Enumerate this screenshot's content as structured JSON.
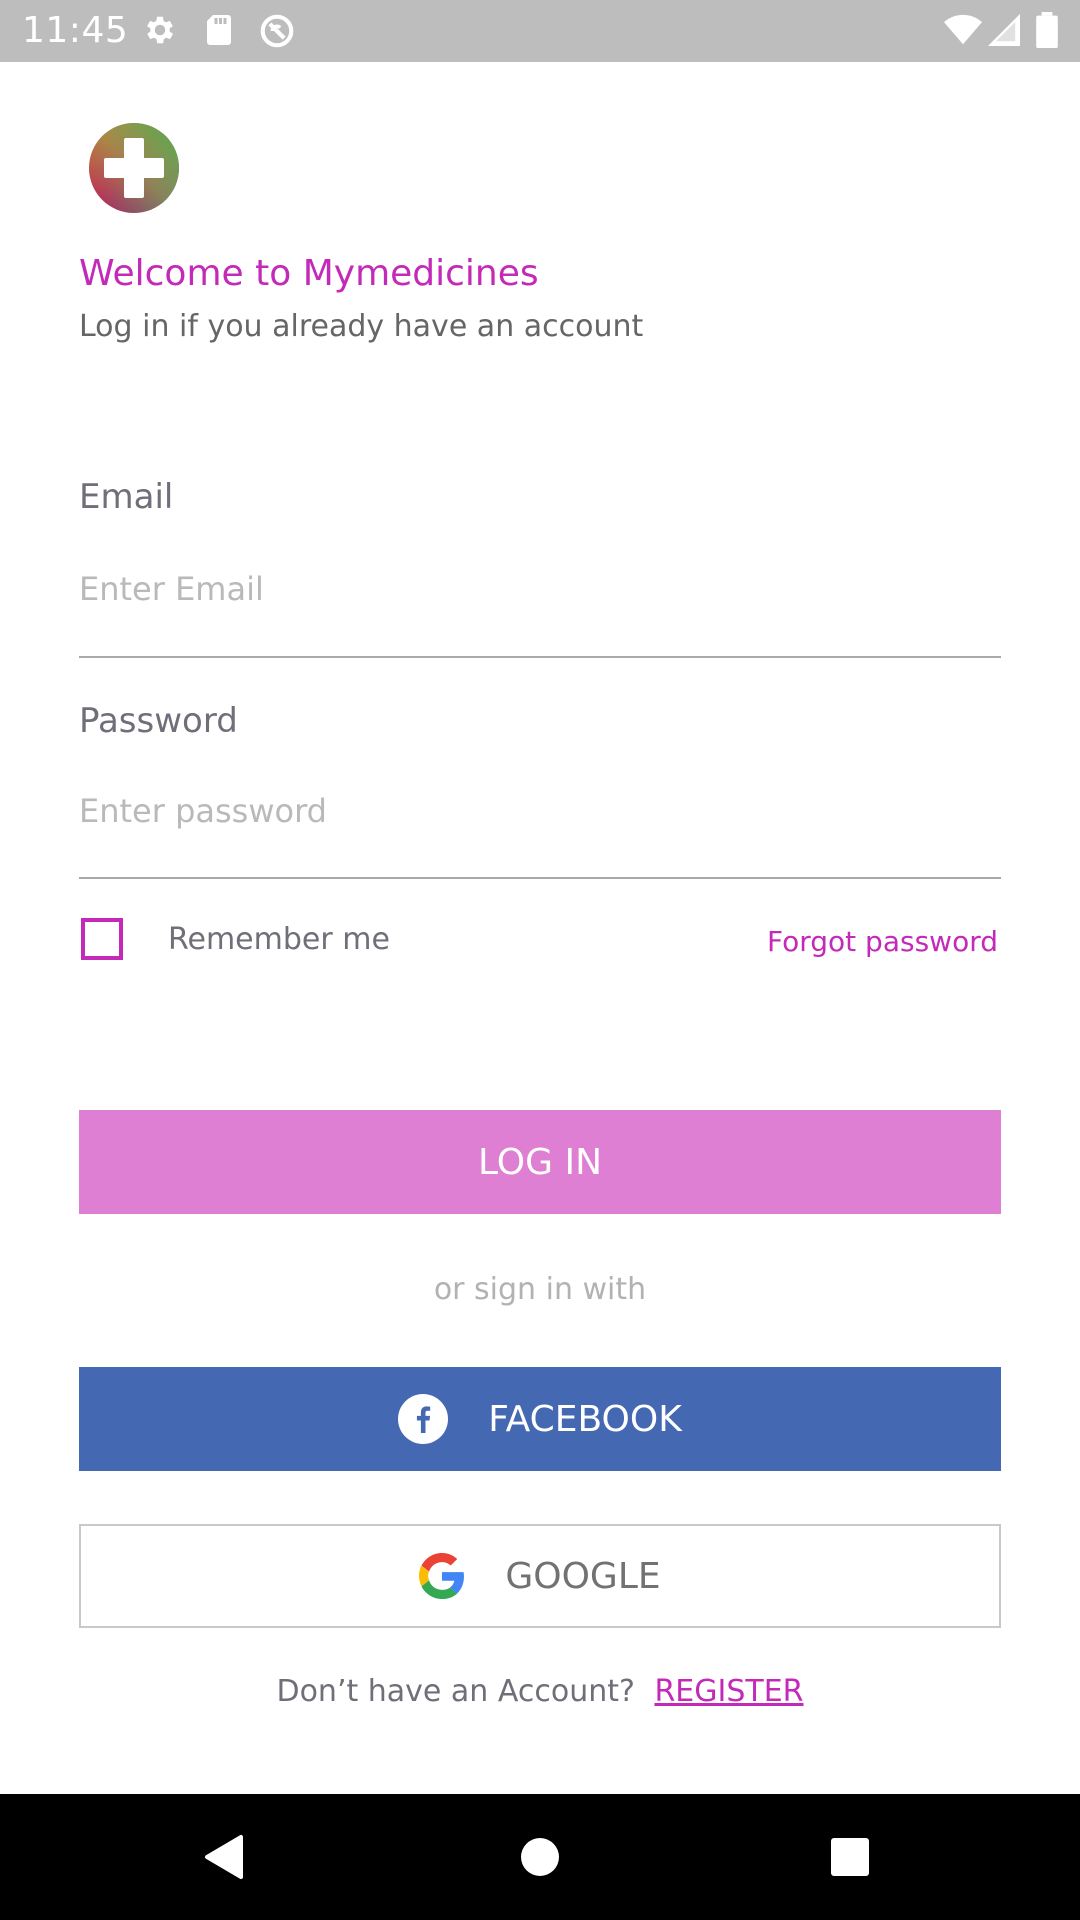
{
  "status_bar": {
    "time": "11:45",
    "icons": [
      "settings-icon",
      "sd-card-icon",
      "sync-blocked-icon",
      "wifi-icon",
      "signal-icon",
      "battery-icon"
    ]
  },
  "app": {
    "logo": "medical-cross-logo",
    "welcome_title": "Welcome to Mymedicines",
    "welcome_subtitle": "Log in if you already have an account"
  },
  "form": {
    "email_label": "Email",
    "email_placeholder": "Enter Email",
    "email_value": "",
    "password_label": "Password",
    "password_placeholder": "Enter password",
    "password_value": "",
    "remember_label": "Remember me",
    "remember_checked": false,
    "forgot_label": "Forgot password"
  },
  "actions": {
    "login_label": "LOG IN",
    "or_text": "or sign in with",
    "facebook_label": "FACEBOOK",
    "google_label": "GOOGLE",
    "no_account_text": "Don’t have an Account?",
    "register_label": "REGISTER"
  },
  "colors": {
    "accent": "#c42ab8",
    "login_button": "#df7fd3",
    "facebook_button": "#4468b2",
    "status_bar": "#bdbdbd",
    "nav_bar": "#000000"
  },
  "nav_bar": {
    "icons": [
      "back-icon",
      "home-icon",
      "recents-icon"
    ]
  }
}
